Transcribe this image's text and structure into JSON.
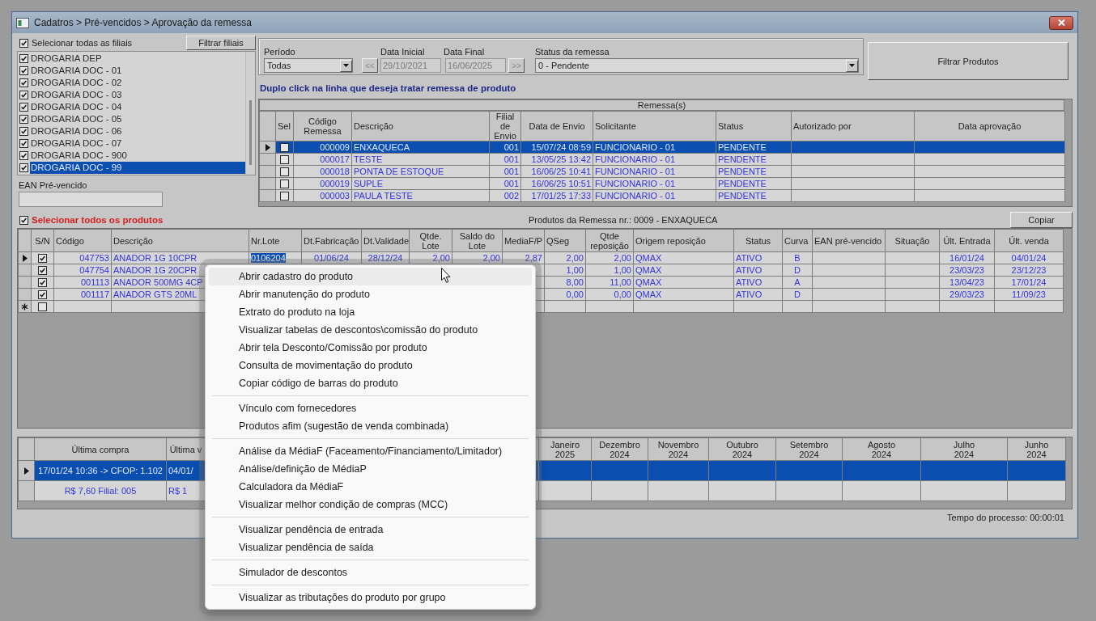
{
  "window": {
    "title": "Cadatros > Pré-vencidos > Aprovação da remessa"
  },
  "filiais": {
    "select_all_label": "Selecionar todas as filiais",
    "select_all_checked": true,
    "filter_button": "Filtrar filiais",
    "items": [
      {
        "label": "DROGARIA DEP",
        "checked": true,
        "selected": false
      },
      {
        "label": "DROGARIA DOC - 01",
        "checked": true,
        "selected": false
      },
      {
        "label": "DROGARIA DOC - 02",
        "checked": true,
        "selected": false
      },
      {
        "label": "DROGARIA DOC - 03",
        "checked": true,
        "selected": false
      },
      {
        "label": "DROGARIA DOC - 04",
        "checked": true,
        "selected": false
      },
      {
        "label": "DROGARIA DOC - 05",
        "checked": true,
        "selected": false
      },
      {
        "label": "DROGARIA DOC - 06",
        "checked": true,
        "selected": false
      },
      {
        "label": "DROGARIA DOC - 07",
        "checked": true,
        "selected": false
      },
      {
        "label": "DROGARIA DOC - 900",
        "checked": true,
        "selected": false
      },
      {
        "label": "DROGARIA DOC - 99",
        "checked": true,
        "selected": true
      }
    ]
  },
  "ean_field": {
    "label": "EAN Pré-vencido"
  },
  "filters": {
    "periodo": {
      "label": "Período",
      "value": "Todas"
    },
    "prev_button": "<<",
    "data_inicial": {
      "label": "Data Inicial",
      "value": "29/10/2021",
      "disabled": true
    },
    "data_final": {
      "label": "Data Final",
      "value": "16/06/2025",
      "disabled": true
    },
    "next_button": ">>",
    "status": {
      "label": "Status da remessa",
      "value": "0 - Pendente"
    },
    "filter_button": "Filtrar Produtos"
  },
  "hint": "Duplo click na linha que deseja tratar remessa de produto",
  "remessas": {
    "title": "Remessa(s)",
    "checkbox_column": "Sel",
    "columns": [
      "Código\nRemessa",
      "Descrição",
      "Filial de\nEnvio",
      "Data de Envio",
      "Solicitante",
      "Status",
      "Autorizado por",
      "Data aprovação"
    ],
    "rows": [
      {
        "selected": true,
        "checked": false,
        "cells": [
          "000009",
          "ENXAQUECA",
          "001",
          "15/07/24 08:59",
          "FUNCIONARIO - 01",
          "PENDENTE"
        ]
      },
      {
        "selected": false,
        "checked": false,
        "cells": [
          "000017",
          "TESTE",
          "001",
          "13/05/25 13:42",
          "FUNCIONARIO - 01",
          "PENDENTE"
        ]
      },
      {
        "selected": false,
        "checked": false,
        "cells": [
          "000018",
          "PONTA DE ESTOQUE",
          "001",
          "16/06/25 10:41",
          "FUNCIONARIO - 01",
          "PENDENTE"
        ]
      },
      {
        "selected": false,
        "checked": false,
        "cells": [
          "000019",
          "SUPLE",
          "001",
          "16/06/25 10:51",
          "FUNCIONARIO - 01",
          "PENDENTE"
        ]
      },
      {
        "selected": false,
        "checked": false,
        "cells": [
          "000003",
          "PAULA TESTE",
          "002",
          "17/01/25 17:33",
          "FUNCIONARIO - 01",
          "PENDENTE"
        ]
      }
    ]
  },
  "produtos": {
    "select_all_label": "Selecionar todos os produtos",
    "select_all_checked": true,
    "title": "Produtos da Remessa nr.: 0009 - ENXAQUECA",
    "copy_button": "Copiar",
    "checkbox_column": "S/N",
    "columns": [
      "Código",
      "Descrição",
      "Nr.Lote",
      "Dt.Fabricação",
      "Dt.Validade",
      "Qtde.\nLote",
      "Saldo do\nLote",
      "MediaF/P",
      "QSeg",
      "Qtde\nreposição",
      "Origem reposição",
      "Status",
      "Curva",
      "EAN pré-vencido",
      "Situação",
      "Últ. Entrada",
      "Últ. venda"
    ],
    "rows": [
      {
        "selected": true,
        "checked": true,
        "cells": [
          "047753",
          "ANADOR 1G 10CPR",
          "0106204",
          "01/06/24",
          "28/12/24",
          "2,00",
          "2,00",
          "2,87",
          "2,00",
          "2,00",
          "QMAX",
          "ATIVO",
          "B",
          null,
          null,
          "16/01/24",
          "04/01/24"
        ]
      },
      {
        "selected": false,
        "checked": true,
        "cells": [
          "047754",
          "ANADOR 1G 20CPR",
          null,
          null,
          null,
          null,
          null,
          null,
          "1,00",
          "1,00",
          "QMAX",
          "ATIVO",
          "D",
          null,
          null,
          "23/03/23",
          "23/12/23"
        ]
      },
      {
        "selected": false,
        "checked": true,
        "cells": [
          "001113",
          "ANADOR 500MG 4CP",
          null,
          null,
          null,
          null,
          null,
          null,
          "8,00",
          "11,00",
          "QMAX",
          "ATIVO",
          "A",
          null,
          null,
          "13/04/23",
          "17/01/24"
        ]
      },
      {
        "selected": false,
        "checked": true,
        "cells": [
          "001117",
          "ANADOR GTS 20ML",
          null,
          null,
          null,
          null,
          null,
          null,
          "0,00",
          "0,00",
          "QMAX",
          "ATIVO",
          "D",
          null,
          null,
          "29/03/23",
          "11/09/23"
        ]
      }
    ],
    "new_row": {
      "checked": false
    }
  },
  "compras": {
    "columns": [
      "Última compra",
      "Última v",
      "Janeiro\n2025",
      "Dezembro\n2024",
      "Novembro\n2024",
      "Outubro\n2024",
      "Setembro\n2024",
      "Agosto\n2024",
      "Julho\n2024",
      "Junho\n2024"
    ],
    "rows": [
      {
        "selected": true,
        "cells": [
          "17/01/24 10:36 -> CFOP: 1.102",
          "04/01/"
        ]
      },
      {
        "selected": false,
        "cells": [
          "R$ 7,60 Filial: 005",
          "R$ 1"
        ]
      }
    ]
  },
  "status_bar": {
    "text": "Tempo do processo: 00:00:01"
  },
  "context_menu": {
    "items": [
      {
        "kind": "item",
        "label": "Abrir cadastro do produto",
        "highlighted": true
      },
      {
        "kind": "item",
        "label": "Abrir manutenção do produto",
        "highlighted": false
      },
      {
        "kind": "item",
        "label": "Extrato do produto na loja",
        "highlighted": false
      },
      {
        "kind": "item",
        "label": "Visualizar tabelas de descontos\\comissão do produto",
        "highlighted": false
      },
      {
        "kind": "item",
        "label": "Abrir tela Desconto/Comissão por produto",
        "highlighted": false
      },
      {
        "kind": "item",
        "label": "Consulta de movimentação do produto",
        "highlighted": false
      },
      {
        "kind": "item",
        "label": "Copiar código de barras do produto",
        "highlighted": false
      },
      {
        "kind": "separator"
      },
      {
        "kind": "item",
        "label": "Vínculo com fornecedores",
        "highlighted": false
      },
      {
        "kind": "item",
        "label": "Produtos afim (sugestão de venda combinada)",
        "highlighted": false
      },
      {
        "kind": "separator"
      },
      {
        "kind": "item",
        "label": "Análise da MédiaF (Faceamento/Financiamento/Limitador)",
        "highlighted": false
      },
      {
        "kind": "item",
        "label": "Análise/definição de MédiaP",
        "highlighted": false
      },
      {
        "kind": "item",
        "label": "Calculadora da MédiaF",
        "highlighted": false
      },
      {
        "kind": "item",
        "label": "Visualizar melhor condição de compras (MCC)",
        "highlighted": false
      },
      {
        "kind": "separator"
      },
      {
        "kind": "item",
        "label": "Visualizar pendência de entrada",
        "highlighted": false
      },
      {
        "kind": "item",
        "label": "Visualizar pendência de saída",
        "highlighted": false
      },
      {
        "kind": "separator"
      },
      {
        "kind": "item",
        "label": "Simulador de descontos",
        "highlighted": false
      },
      {
        "kind": "separator"
      },
      {
        "kind": "item",
        "label": "Visualizar as tributações do produto por grupo",
        "highlighted": false
      }
    ]
  }
}
